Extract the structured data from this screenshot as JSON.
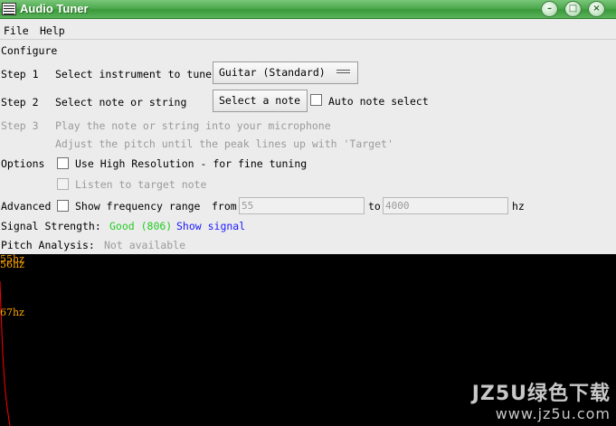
{
  "window": {
    "title": "Audio Tuner",
    "controls": {
      "minimize": "–",
      "maximize": "□",
      "close": "×"
    }
  },
  "menu": {
    "file": "File",
    "help": "Help"
  },
  "section_title": "Configure",
  "step1": {
    "label": "Step 1",
    "text": "Select instrument to tune",
    "instrument_value": "Guitar (Standard)"
  },
  "step2": {
    "label": "Step 2",
    "text": "Select note or string",
    "select_button": "Select a note",
    "auto_label": "Auto note select"
  },
  "step3": {
    "label": "Step 3",
    "line1": "Play the note or string into your microphone",
    "line2": "Adjust the pitch until the peak lines up with 'Target'"
  },
  "options": {
    "label": "Options",
    "high_res": "Use High Resolution - for fine tuning",
    "listen": "Listen to target note"
  },
  "advanced": {
    "label": "Advanced",
    "show_range": "Show frequency range",
    "from_label": "from",
    "from_value": "55",
    "to_label": "to",
    "to_value": "4000",
    "unit": "hz"
  },
  "signal": {
    "label": "Signal Strength:",
    "value": "Good (806)",
    "link": "Show signal",
    "value_color": "#22cc22",
    "link_color": "#1a1aff"
  },
  "pitch": {
    "label": "Pitch Analysis:",
    "value": "Not available"
  },
  "graph": {
    "labels": [
      "55hz",
      "56hz",
      "67hz"
    ],
    "trace_color": "#ff0000",
    "label_color": "#ffa500"
  },
  "watermark": {
    "line1": "JZ5U绿色下载",
    "line2": "www.jz5u.com"
  }
}
